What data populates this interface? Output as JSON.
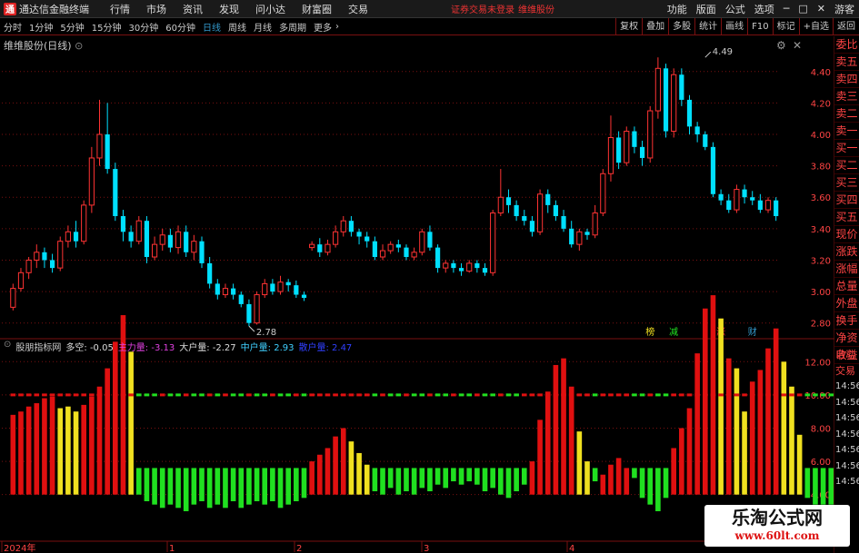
{
  "app": {
    "title": "通达信金融终端",
    "menu": [
      "行情",
      "市场",
      "资讯",
      "发现",
      "问小达",
      "财富圈",
      "交易"
    ],
    "notice": "证券交易未登录",
    "notice_stock": "维维股份",
    "right_menu": [
      "功能",
      "版面",
      "公式",
      "选项",
      "游客"
    ]
  },
  "toolbar": {
    "periods": [
      "分时",
      "1分钟",
      "5分钟",
      "15分钟",
      "30分钟",
      "60分钟",
      "日线",
      "周线",
      "月线",
      "多周期",
      "更多"
    ],
    "active": "日线",
    "tools": [
      "复权",
      "叠加",
      "多股",
      "统计",
      "画线",
      "F10",
      "标记",
      "+自选",
      "返回"
    ]
  },
  "stock": {
    "name": "维维股份(日线)"
  },
  "side_tabs": [
    "委比",
    "卖五",
    "卖四",
    "卖三",
    "卖二",
    "卖一",
    "买一",
    "买二",
    "买三",
    "买四",
    "买五",
    "现价",
    "涨跌",
    "涨幅",
    "总量",
    "外盘",
    "换手",
    "净资",
    "收益"
  ],
  "side_tabs2": [
    "自动",
    "交易",
    "14:56",
    "14:56",
    "14:56",
    "14:56",
    "14:56",
    "14:56",
    "14:56"
  ],
  "indicator": {
    "name": "股朋指标网",
    "duokong": "多空: -0.05",
    "zhuli": "主力量: -3.13",
    "dahu": "大户量: -2.27",
    "zhonghu": "中户量: 2.93",
    "sanhu": "散户量: 2.47"
  },
  "colors": {
    "up": "#ff3333",
    "down": "#00e0ff",
    "grid": "#7a1010",
    "bar_red": "#e01010",
    "bar_yellow": "#f0e020",
    "bar_green": "#20e020"
  },
  "watermark": {
    "line1": "乐淘公式网",
    "line2": "www.60lt.com"
  },
  "chart_data": {
    "type": "candlestick",
    "price_ticks": [
      4.4,
      4.2,
      4.0,
      3.8,
      3.6,
      3.4,
      3.2,
      3.0,
      2.8
    ],
    "indicator_ticks": [
      12.0,
      10.0,
      8.0,
      6.0,
      4.0
    ],
    "x_labels": [
      "2024年",
      "1",
      "2",
      "3",
      "4"
    ],
    "annotations": [
      {
        "text": "2.78",
        "bar": 30,
        "price": 2.78
      },
      {
        "text": "4.49",
        "bar": 88,
        "price": 4.49
      }
    ],
    "event_tags": [
      {
        "text": "榜",
        "bar": 81,
        "color": "#f0e020"
      },
      {
        "text": "减",
        "bar": 84,
        "color": "#20e020"
      },
      {
        "text": "涨",
        "bar": 90,
        "color": "#ff3333"
      },
      {
        "text": "财",
        "bar": 94,
        "color": "#39c"
      }
    ],
    "candles": [
      [
        2.9,
        3.02,
        3.05,
        2.88
      ],
      [
        3.02,
        3.12,
        3.15,
        3.0
      ],
      [
        3.12,
        3.2,
        3.22,
        3.08
      ],
      [
        3.2,
        3.25,
        3.3,
        3.15
      ],
      [
        3.25,
        3.2,
        3.28,
        3.15
      ],
      [
        3.2,
        3.15,
        3.24,
        3.12
      ],
      [
        3.15,
        3.32,
        3.35,
        3.13
      ],
      [
        3.32,
        3.38,
        3.42,
        3.28
      ],
      [
        3.38,
        3.32,
        3.45,
        3.28
      ],
      [
        3.32,
        3.55,
        3.58,
        3.3
      ],
      [
        3.55,
        3.85,
        3.92,
        3.5
      ],
      [
        3.85,
        4.0,
        4.22,
        3.8
      ],
      [
        4.0,
        3.78,
        4.2,
        3.75
      ],
      [
        3.78,
        3.48,
        3.82,
        3.45
      ],
      [
        3.48,
        3.38,
        3.52,
        3.32
      ],
      [
        3.38,
        3.32,
        3.42,
        3.28
      ],
      [
        3.32,
        3.45,
        3.48,
        3.3
      ],
      [
        3.45,
        3.22,
        3.48,
        3.18
      ],
      [
        3.22,
        3.3,
        3.35,
        3.2
      ],
      [
        3.3,
        3.36,
        3.4,
        3.26
      ],
      [
        3.36,
        3.28,
        3.4,
        3.25
      ],
      [
        3.28,
        3.38,
        3.42,
        3.24
      ],
      [
        3.38,
        3.25,
        3.42,
        3.22
      ],
      [
        3.25,
        3.32,
        3.36,
        3.2
      ],
      [
        3.32,
        3.18,
        3.35,
        3.15
      ],
      [
        3.18,
        3.05,
        3.22,
        3.02
      ],
      [
        3.05,
        2.98,
        3.08,
        2.95
      ],
      [
        2.98,
        3.02,
        3.05,
        2.96
      ],
      [
        3.02,
        2.98,
        3.05,
        2.95
      ],
      [
        2.98,
        2.92,
        3.0,
        2.9
      ],
      [
        2.92,
        2.8,
        2.95,
        2.78
      ],
      [
        2.8,
        2.98,
        3.0,
        2.79
      ],
      [
        2.98,
        3.05,
        3.08,
        2.96
      ],
      [
        3.05,
        3.0,
        3.08,
        2.98
      ],
      [
        3.0,
        3.06,
        3.1,
        2.98
      ],
      [
        3.06,
        3.04,
        3.08,
        3.0
      ],
      [
        3.04,
        2.98,
        3.07,
        2.96
      ],
      [
        2.98,
        2.96,
        3.0,
        2.94
      ],
      [
        3.28,
        3.3,
        3.32,
        3.26
      ],
      [
        3.3,
        3.25,
        3.34,
        3.22
      ],
      [
        3.25,
        3.3,
        3.33,
        3.23
      ],
      [
        3.3,
        3.38,
        3.42,
        3.28
      ],
      [
        3.38,
        3.45,
        3.48,
        3.35
      ],
      [
        3.45,
        3.38,
        3.48,
        3.35
      ],
      [
        3.38,
        3.35,
        3.4,
        3.3
      ],
      [
        3.35,
        3.32,
        3.38,
        3.28
      ],
      [
        3.32,
        3.22,
        3.35,
        3.2
      ],
      [
        3.22,
        3.26,
        3.3,
        3.2
      ],
      [
        3.26,
        3.3,
        3.32,
        3.24
      ],
      [
        3.3,
        3.28,
        3.33,
        3.25
      ],
      [
        3.28,
        3.22,
        3.3,
        3.2
      ],
      [
        3.22,
        3.25,
        3.28,
        3.2
      ],
      [
        3.25,
        3.38,
        3.4,
        3.23
      ],
      [
        3.38,
        3.28,
        3.42,
        3.26
      ],
      [
        3.28,
        3.15,
        3.3,
        3.12
      ],
      [
        3.15,
        3.18,
        3.2,
        3.12
      ],
      [
        3.18,
        3.15,
        3.2,
        3.12
      ],
      [
        3.15,
        3.13,
        3.18,
        3.1
      ],
      [
        3.13,
        3.18,
        3.2,
        3.12
      ],
      [
        3.18,
        3.15,
        3.2,
        3.12
      ],
      [
        3.15,
        3.12,
        3.18,
        3.1
      ],
      [
        3.12,
        3.5,
        3.52,
        3.1
      ],
      [
        3.5,
        3.6,
        3.78,
        3.48
      ],
      [
        3.6,
        3.55,
        3.65,
        3.5
      ],
      [
        3.55,
        3.48,
        3.58,
        3.45
      ],
      [
        3.48,
        3.45,
        3.52,
        3.42
      ],
      [
        3.45,
        3.38,
        3.48,
        3.35
      ],
      [
        3.38,
        3.62,
        3.65,
        3.36
      ],
      [
        3.62,
        3.55,
        3.65,
        3.5
      ],
      [
        3.55,
        3.48,
        3.58,
        3.45
      ],
      [
        3.48,
        3.4,
        3.52,
        3.38
      ],
      [
        3.4,
        3.3,
        3.45,
        3.28
      ],
      [
        3.3,
        3.38,
        3.4,
        3.26
      ],
      [
        3.38,
        3.36,
        3.4,
        3.33
      ],
      [
        3.36,
        3.5,
        3.55,
        3.34
      ],
      [
        3.5,
        3.75,
        3.78,
        3.48
      ],
      [
        3.75,
        3.98,
        4.12,
        3.7
      ],
      [
        3.98,
        3.82,
        4.02,
        3.78
      ],
      [
        3.82,
        4.02,
        4.05,
        3.8
      ],
      [
        4.02,
        3.92,
        4.05,
        3.88
      ],
      [
        3.92,
        3.85,
        3.96,
        3.8
      ],
      [
        3.85,
        4.15,
        4.18,
        3.82
      ],
      [
        4.15,
        4.42,
        4.49,
        4.1
      ],
      [
        4.42,
        4.02,
        4.45,
        3.98
      ],
      [
        4.02,
        4.38,
        4.42,
        3.98
      ],
      [
        4.38,
        4.22,
        4.42,
        4.18
      ],
      [
        4.22,
        4.05,
        4.25,
        4.0
      ],
      [
        4.05,
        4.0,
        4.08,
        3.95
      ],
      [
        4.0,
        3.92,
        4.02,
        3.9
      ],
      [
        3.92,
        3.62,
        3.95,
        3.6
      ],
      [
        3.62,
        3.58,
        3.65,
        3.55
      ],
      [
        3.58,
        3.52,
        3.62,
        3.5
      ],
      [
        3.52,
        3.65,
        3.68,
        3.5
      ],
      [
        3.65,
        3.6,
        3.68,
        3.56
      ],
      [
        3.6,
        3.58,
        3.64,
        3.55
      ],
      [
        3.58,
        3.52,
        3.62,
        3.5
      ],
      [
        3.52,
        3.58,
        3.6,
        3.5
      ],
      [
        3.58,
        3.48,
        3.6,
        3.45
      ]
    ],
    "indicator_bars": [
      4.8,
      5.0,
      5.3,
      5.5,
      5.8,
      5.9,
      5.2,
      5.3,
      5.0,
      5.4,
      5.9,
      6.5,
      7.6,
      9.2,
      10.8,
      8.6,
      -1.6,
      -2.0,
      -2.2,
      -2.4,
      -2.2,
      -2.4,
      -2.6,
      -2.2,
      -2.0,
      -2.4,
      -2.2,
      -2.4,
      -2.0,
      -2.4,
      -2.2,
      -2.0,
      -2.2,
      -2.0,
      -2.4,
      -2.2,
      -2.0,
      -1.8,
      2.0,
      2.4,
      2.8,
      3.5,
      4.0,
      3.2,
      2.5,
      1.8,
      -1.4,
      -1.6,
      -1.2,
      -1.6,
      -1.4,
      -1.6,
      -1.2,
      -1.4,
      -1.0,
      -1.2,
      -0.8,
      -1.0,
      -0.8,
      -1.0,
      -1.4,
      -1.2,
      -1.6,
      -1.8,
      -1.4,
      -1.0,
      2.0,
      4.5,
      6.2,
      7.8,
      8.2,
      6.5,
      3.8,
      2.0,
      -0.8,
      1.2,
      1.8,
      2.2,
      1.6,
      -0.6,
      -1.8,
      -2.2,
      -2.6,
      -1.8,
      2.8,
      4.0,
      5.2,
      8.5,
      11.2,
      12.0,
      10.6,
      8.2,
      7.6,
      5.0,
      6.8,
      7.5,
      8.8,
      10.0,
      8.0,
      6.5,
      3.6,
      -1.8,
      -2.2,
      -2.2,
      -2.2,
      -2.2,
      -2.2,
      -2.2,
      -2.2,
      -2.2,
      -2.2
    ],
    "indicator_colors": [
      "r",
      "r",
      "r",
      "r",
      "r",
      "r",
      "y",
      "y",
      "y",
      "r",
      "r",
      "r",
      "r",
      "r",
      "r",
      "y",
      "g",
      "g",
      "g",
      "g",
      "g",
      "g",
      "g",
      "g",
      "g",
      "g",
      "g",
      "g",
      "g",
      "g",
      "g",
      "g",
      "g",
      "g",
      "g",
      "g",
      "g",
      "g",
      "r",
      "r",
      "r",
      "r",
      "r",
      "y",
      "y",
      "y",
      "g",
      "g",
      "g",
      "g",
      "g",
      "g",
      "g",
      "g",
      "g",
      "g",
      "g",
      "g",
      "g",
      "g",
      "g",
      "g",
      "g",
      "g",
      "g",
      "g",
      "r",
      "r",
      "r",
      "r",
      "r",
      "r",
      "y",
      "y",
      "g",
      "r",
      "r",
      "r",
      "r",
      "g",
      "g",
      "g",
      "g",
      "g",
      "r",
      "r",
      "r",
      "r",
      "r",
      "r",
      "y",
      "r",
      "y",
      "y",
      "r",
      "r",
      "r",
      "r",
      "y",
      "y",
      "y",
      "g",
      "g",
      "g",
      "g",
      "g",
      "g",
      "g",
      "g",
      "g",
      "g"
    ],
    "dash_values": [
      "r",
      "r",
      "r",
      "r",
      "r",
      "r",
      "r",
      "r",
      "r",
      "r",
      "r",
      "r",
      "r",
      "r",
      "r",
      "r",
      "g",
      "g",
      "g",
      "r",
      "g",
      "g",
      "r",
      "g",
      "g",
      "r",
      "g",
      "r",
      "g",
      "g",
      "r",
      "g",
      "g",
      "r",
      "g",
      "g",
      "r",
      "g",
      "r",
      "r",
      "r",
      "r",
      "r",
      "r",
      "r",
      "r",
      "g",
      "r",
      "g",
      "g",
      "r",
      "g",
      "g",
      "r",
      "g",
      "g",
      "r",
      "g",
      "g",
      "r",
      "g",
      "g",
      "r",
      "g",
      "g",
      "r",
      "r",
      "r",
      "r",
      "r",
      "r",
      "r",
      "r",
      "r",
      "g",
      "r",
      "r",
      "r",
      "r",
      "g",
      "g",
      "r",
      "g",
      "g",
      "r",
      "r",
      "r",
      "r",
      "r",
      "r",
      "r",
      "r",
      "r",
      "r",
      "r",
      "r",
      "r",
      "r",
      "r",
      "r",
      "r",
      "g",
      "g",
      "g",
      "g",
      "g",
      "g",
      "g",
      "g",
      "g",
      "g"
    ]
  }
}
